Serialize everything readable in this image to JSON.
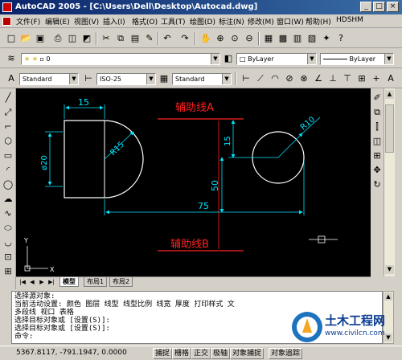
{
  "window": {
    "title": "AutoCAD 2005 - [C:\\Users\\Dell\\Desktop\\Autocad.dwg]",
    "minimize": "_",
    "maximize": "□",
    "close": "×"
  },
  "menu": {
    "items": [
      "文件(F)",
      "编辑(E)",
      "视图(V)",
      "插入(I)",
      "格式(O)",
      "工具(T)",
      "绘图(D)",
      "标注(N)",
      "修改(M)",
      "窗口(W)",
      "帮助(H)",
      "HDSHM"
    ]
  },
  "layers": {
    "current_layer": "0",
    "color": "ByLayer",
    "linetype": "ByLayer"
  },
  "styles": {
    "text_style": "Standard",
    "dim_style": "ISO-25",
    "table_style": "Standard"
  },
  "drawing": {
    "aux_line_a": "辅助线A",
    "aux_line_b": "辅助线B",
    "dim_15_top": "15",
    "dim_15_vert": "15",
    "dim_phi20": "ø20",
    "dim_r15": "R15",
    "dim_r10": "R10",
    "dim_50": "50",
    "dim_75": "75",
    "ucs_x": "X",
    "ucs_y": "Y"
  },
  "tabs": {
    "model": "模型",
    "layout1": "布局1",
    "layout2": "布局2"
  },
  "command": {
    "lines": [
      "选择源对象:",
      "当前活动设置: 颜色 图层 线型 线型比例 线宽 厚度 打印样式 文",
      "多段线 视口 表格",
      "选择目标对象或 [设置(S)]:",
      "选择目标对象或 [设置(S)]:",
      "命令:"
    ]
  },
  "status": {
    "coords": "5367.8117, -791.1947, 0.0000",
    "buttons": [
      "捕捉",
      "栅格",
      "正交",
      "极轴",
      "对象捕捉",
      "对象追踪"
    ]
  },
  "watermark": {
    "site_name": "土木工程网",
    "site_url": "www.civilcn.com"
  },
  "colors": {
    "canvas": "#000000",
    "aux_red": "#ff2020",
    "dim_cyan": "#00e5ff",
    "geometry_white": "#ffffff",
    "title_blue": "#0a246a"
  }
}
